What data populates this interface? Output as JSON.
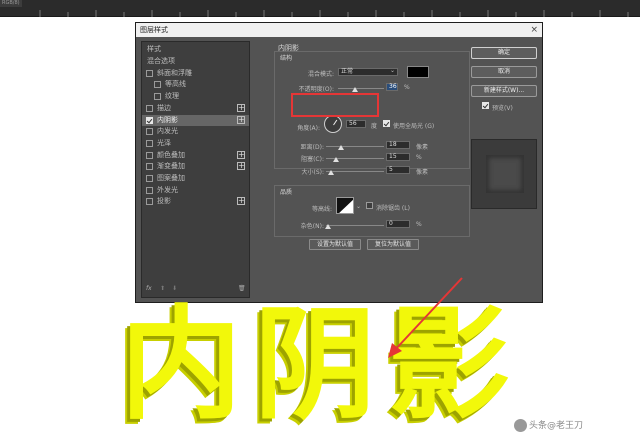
{
  "ruler": {
    "tag": "RGB/8)"
  },
  "dialog": {
    "title": "图层样式",
    "close": "×",
    "left_panel": {
      "header": "样式",
      "items": [
        {
          "label": "混合选项",
          "checkbox": false,
          "checked": false,
          "plus": false,
          "active": false
        },
        {
          "label": "斜面和浮雕",
          "checkbox": true,
          "checked": false,
          "plus": false,
          "active": false
        },
        {
          "label": "等高线",
          "checkbox": true,
          "checked": false,
          "plus": false,
          "active": false,
          "indent": true
        },
        {
          "label": "纹理",
          "checkbox": true,
          "checked": false,
          "plus": false,
          "active": false,
          "indent": true
        },
        {
          "label": "描边",
          "checkbox": true,
          "checked": false,
          "plus": true,
          "active": false
        },
        {
          "label": "内阴影",
          "checkbox": true,
          "checked": true,
          "plus": true,
          "active": true
        },
        {
          "label": "内发光",
          "checkbox": true,
          "checked": false,
          "plus": false,
          "active": false
        },
        {
          "label": "光泽",
          "checkbox": true,
          "checked": false,
          "plus": false,
          "active": false
        },
        {
          "label": "颜色叠加",
          "checkbox": true,
          "checked": false,
          "plus": true,
          "active": false
        },
        {
          "label": "渐变叠加",
          "checkbox": true,
          "checked": false,
          "plus": true,
          "active": false
        },
        {
          "label": "图案叠加",
          "checkbox": true,
          "checked": false,
          "plus": false,
          "active": false
        },
        {
          "label": "外发光",
          "checkbox": true,
          "checked": false,
          "plus": false,
          "active": false
        },
        {
          "label": "投影",
          "checkbox": true,
          "checked": false,
          "plus": true,
          "active": false
        }
      ],
      "footer": {
        "fx": "fx",
        "up": "⬆",
        "down": "⬇",
        "trash": "🗑"
      }
    },
    "inner_shadow": {
      "section_title": "内阴影",
      "structure_title": "结构",
      "blend_mode_label": "混合模式:",
      "blend_mode_value": "正常",
      "blend_color": "#000000",
      "opacity_label": "不透明度(O):",
      "opacity_value": "36",
      "opacity_unit": "%",
      "opacity_fraction": 0.36,
      "angle_label": "角度(A):",
      "angle_value": "56",
      "angle_unit": "度",
      "global_light_label": "使用全局光 (G)",
      "distance_label": "距离(D):",
      "distance_value": "18",
      "distance_unit": "像素",
      "choke_label": "阻塞(C):",
      "choke_value": "15",
      "choke_unit": "%",
      "size_label": "大小(S):",
      "size_value": "5",
      "size_unit": "像素",
      "quality_title": "品质",
      "contour_label": "等高线:",
      "antialias_label": "消除锯齿 (L)",
      "noise_label": "杂色(N):",
      "noise_value": "0",
      "noise_unit": "%",
      "default_button": "设置为默认值",
      "reset_button": "复位为默认值"
    },
    "right_panel": {
      "ok": "确定",
      "cancel": "取消",
      "new_style": "新建样式(W)...",
      "preview_label": "预览(V)"
    }
  },
  "canvas_text": "内阴影",
  "canvas_text_color": "#f2f80a",
  "annotation_color": "#e53636",
  "watermark": "头条@老王刀"
}
